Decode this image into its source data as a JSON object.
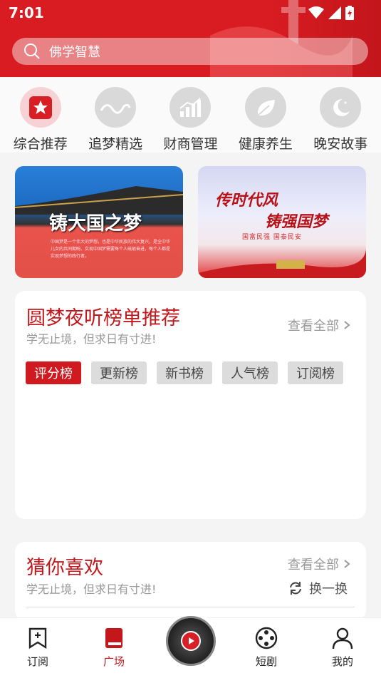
{
  "status": {
    "time": "7:01"
  },
  "search": {
    "placeholder": "佛学智慧"
  },
  "categories": [
    {
      "label": "综合推荐",
      "icon": "star-icon"
    },
    {
      "label": "追梦精选",
      "icon": "dream-logo-icon"
    },
    {
      "label": "财商管理",
      "icon": "bar-chart-icon"
    },
    {
      "label": "健康养生",
      "icon": "leaf-icon"
    },
    {
      "label": "晚安故事",
      "icon": "moon-icon"
    }
  ],
  "banners": [
    {
      "title": "铸大国之梦",
      "text": "中国梦是一个伟大的梦想，也是中华民族的伟大复兴，是全中华儿女的共同期盼。实现中国梦需要每个人砥砺奋进，每个人都是实现梦想的践行者。"
    },
    {
      "line1": "传时代风",
      "line2": "铸强国梦",
      "line3": "国富民强  国泰民安"
    }
  ],
  "rank": {
    "title": "圆梦夜听榜单推荐",
    "subtitle": "学无止境，但求日有寸进!",
    "more": "查看全部",
    "tabs": [
      "评分榜",
      "更新榜",
      "新书榜",
      "人气榜",
      "订阅榜"
    ]
  },
  "guess": {
    "title": "猜你喜欢",
    "subtitle": "学无止境，但求日有寸进!",
    "more": "查看全部",
    "swap": "换一换"
  },
  "nav": {
    "subscribe": "订阅",
    "square": "广场",
    "drama": "短剧",
    "mine": "我的"
  },
  "colors": {
    "brand": "#d81c22",
    "accent_text": "#c4171c"
  }
}
